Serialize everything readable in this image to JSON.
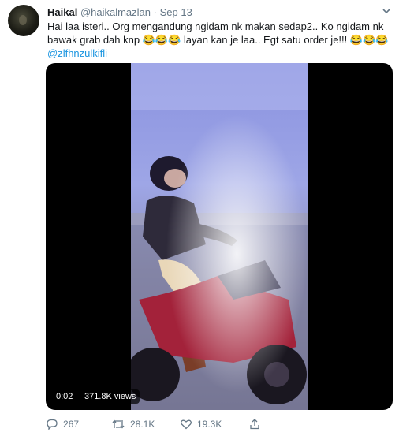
{
  "tweet": {
    "name": "Haikal",
    "handle": "@haikalmazlan",
    "separator": "·",
    "date": "Sep 13",
    "text": "Hai laa isteri.. Org mengandung ngidam nk makan sedap2.. Ko ngidam nk bawak grab dah knp 😂😂😂 layan kan je laa.. Egt satu order je!!! 😂😂😂",
    "mention": "@zlfhnzulkifli"
  },
  "video": {
    "time": "0:02",
    "views": "371.8K views"
  },
  "actions": {
    "replies": "267",
    "retweets": "28.1K",
    "likes": "19.3K"
  },
  "colors": {
    "accent": "#1b95e0",
    "muted": "#657786",
    "text": "#14171a"
  },
  "icons": [
    "reply-icon",
    "retweet-icon",
    "like-icon",
    "share-icon",
    "caret-down-icon"
  ]
}
